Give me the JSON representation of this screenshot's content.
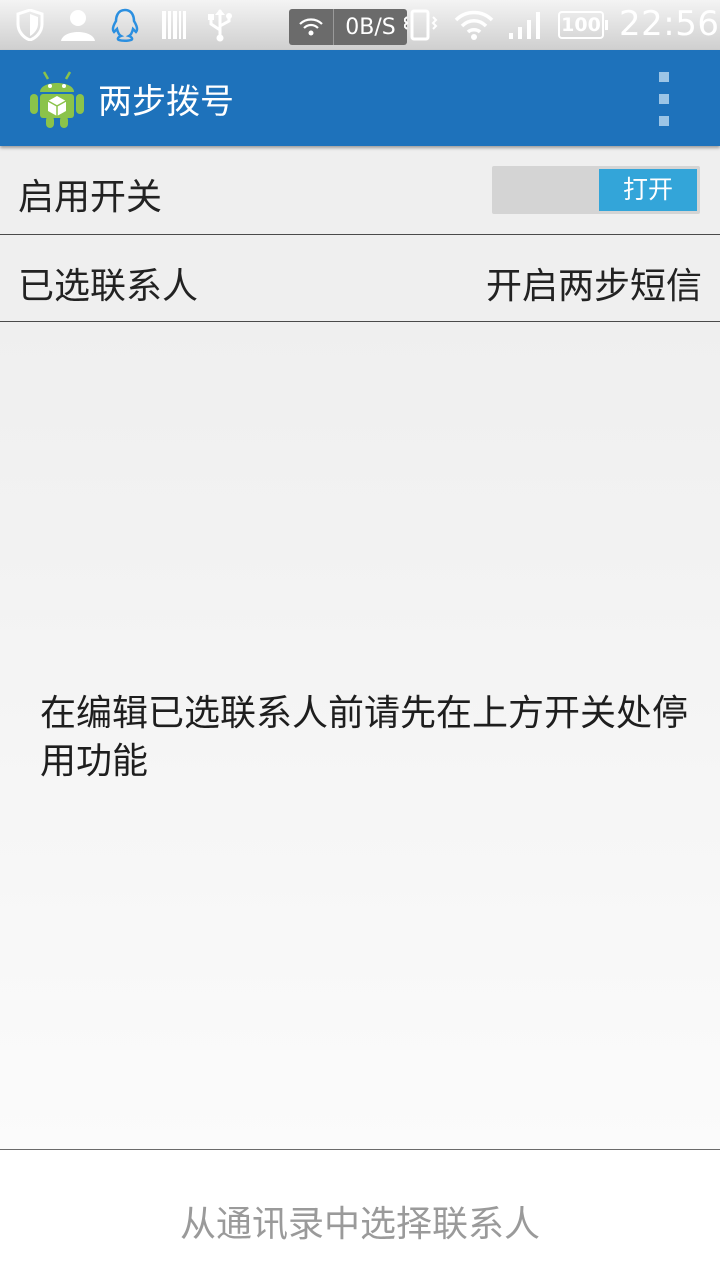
{
  "status_bar": {
    "network_speed": "0B/S",
    "battery_level": "100",
    "time": "22:56",
    "icons": [
      "shield-icon",
      "person-icon",
      "qq-penguin-icon",
      "barcode-icon",
      "usb-icon",
      "wifi-icon",
      "vibrate-icon",
      "wifi-icon",
      "signal-icon",
      "battery-icon"
    ]
  },
  "action_bar": {
    "title": "两步拨号",
    "app_icon": "android-app-icon",
    "overflow_icon": "overflow-menu-icon",
    "color": "#1e72bb"
  },
  "settings": {
    "enable_label": "启用开关",
    "toggle_state": "打开",
    "toggle_color": "#33a5d9",
    "contacts_label": "已选联系人",
    "sms_label": "开启两步短信"
  },
  "content": {
    "hint": "在编辑已选联系人前请先在上方开关处停用功能"
  },
  "bottom": {
    "select_contacts": "从通讯录中选择联系人"
  }
}
